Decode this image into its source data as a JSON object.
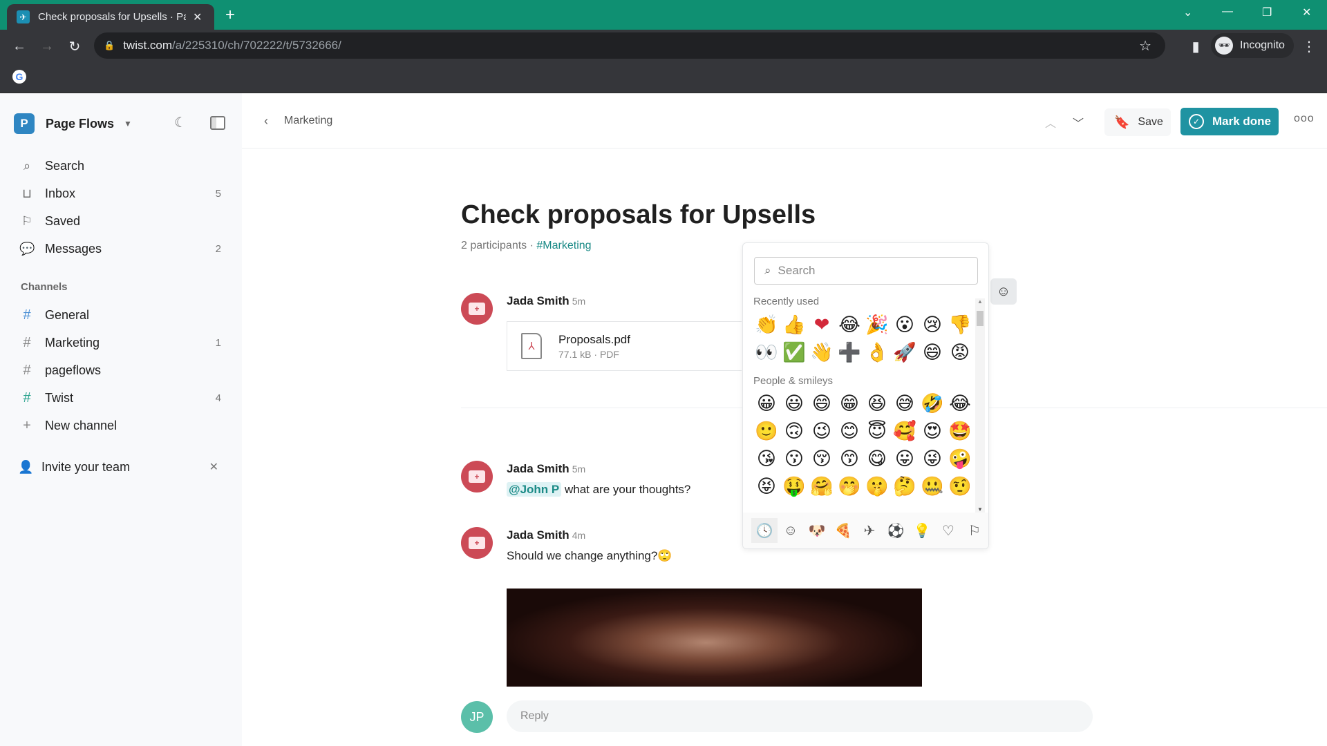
{
  "browser": {
    "tab_title": "Check proposals for Upsells · Page Flows",
    "url_host": "twist.com",
    "url_path": "/a/225310/ch/702222/t/5732666/",
    "profile_label": "Incognito"
  },
  "sidebar": {
    "workspace_initial": "P",
    "workspace_name": "Page Flows",
    "nav": [
      {
        "label": "Search",
        "icon": "search-icon",
        "count": ""
      },
      {
        "label": "Inbox",
        "icon": "inbox-icon",
        "count": "5"
      },
      {
        "label": "Saved",
        "icon": "bookmark-icon",
        "count": ""
      },
      {
        "label": "Messages",
        "icon": "chat-icon",
        "count": "2"
      }
    ],
    "channels_label": "Channels",
    "channels": [
      {
        "label": "General",
        "count": "",
        "color": "#4a8fd4"
      },
      {
        "label": "Marketing",
        "count": "1",
        "color": "#888888"
      },
      {
        "label": "pageflows",
        "count": "",
        "color": "#888888"
      },
      {
        "label": "Twist",
        "count": "4",
        "color": "#2aa38e"
      }
    ],
    "new_channel_label": "New channel",
    "invite_label": "Invite your team"
  },
  "header": {
    "breadcrumb": "Marketing",
    "save_label": "Save",
    "mark_done_label": "Mark done",
    "accent_color": "#1f93a2"
  },
  "thread": {
    "title": "Check proposals for Upsells",
    "participants": "2 participants",
    "channel_link": "#Marketing",
    "messages": [
      {
        "author": "Jada Smith",
        "time": "5m",
        "attachment": {
          "name": "Proposals.pdf",
          "size": "77.1 kB",
          "type": "PDF"
        }
      },
      {
        "author": "Jada Smith",
        "time": "5m",
        "mention": "@John P",
        "text": " what are your thoughts?"
      },
      {
        "author": "Jada Smith",
        "time": "4m",
        "text": "Should we change anything?",
        "emoji": "🙄"
      }
    ],
    "reply_initials": "JP",
    "reply_placeholder": "Reply"
  },
  "emoji_picker": {
    "search_placeholder": "Search",
    "recently_used_label": "Recently used",
    "recently_used": [
      [
        "👏",
        "👍",
        "❤",
        "😂",
        "🎉",
        "😮",
        "😢",
        "👎"
      ],
      [
        "👀",
        "✅",
        "👋",
        "➕",
        "👌",
        "🚀",
        "😄",
        "😡"
      ]
    ],
    "people_label": "People & smileys",
    "people": [
      [
        "😀",
        "😃",
        "😄",
        "😁",
        "😆",
        "😅",
        "🤣",
        "😂"
      ],
      [
        "🙂",
        "🙃",
        "😉",
        "😊",
        "😇",
        "🥰",
        "😍",
        "🤩"
      ],
      [
        "😘",
        "😗",
        "😚",
        "😙",
        "😋",
        "😛",
        "😜",
        "🤪"
      ],
      [
        "😝",
        "🤑",
        "🤗",
        "🤭",
        "🤫",
        "🤔",
        "🤐",
        "🤨"
      ]
    ],
    "categories": [
      "recent-icon",
      "smiley-icon",
      "animal-icon",
      "food-icon",
      "travel-icon",
      "activity-icon",
      "objects-icon",
      "symbols-icon",
      "flags-icon"
    ]
  }
}
